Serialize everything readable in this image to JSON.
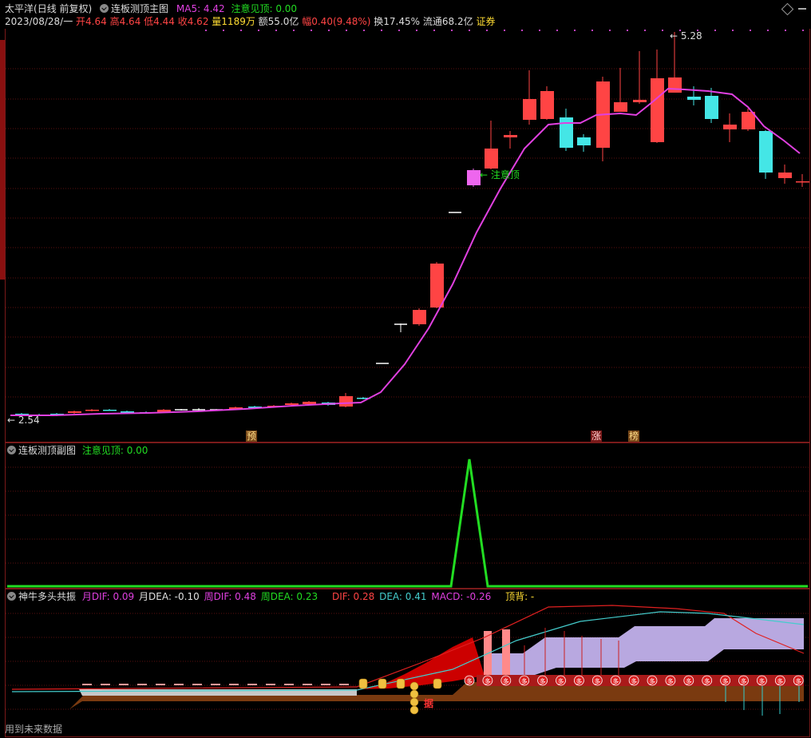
{
  "header": {
    "stock_name": "太平洋",
    "period": "(日线 前复权)",
    "main_indicator": "连板测顶主图",
    "ma5_label": "MA5: 4.42",
    "warn_label": "注意见顶: 0.00",
    "date": "2023/08/28/一",
    "open": "开4.64",
    "high": "高4.64",
    "low": "低4.44",
    "close": "收4.62",
    "volume": "量1189万",
    "amount": "额55.0亿",
    "change": "幅0.40(9.48%)",
    "turnover": "换17.45%",
    "float_cap": "流通68.2亿",
    "sector": "证券"
  },
  "main_chart": {
    "high_mark": "5.28",
    "low_mark": "2.54",
    "annotation": "注意顶",
    "tag_yu": "预",
    "tag_zhang": "涨",
    "tag_bang": "榜",
    "colors": {
      "up": "#ff4444",
      "down": "#44e6e6",
      "ma5": "#e040e0",
      "bg": "#000000"
    }
  },
  "sub_chart": {
    "title": "连板测顶副图",
    "value_label": "注意见顶: 0.00",
    "colors": {
      "line": "#22dd22"
    }
  },
  "macd_chart": {
    "title": "神牛多头共振",
    "m_dif": "月DIF: 0.09",
    "m_dea": "月DEA: -0.10",
    "w_dif": "周DIF: 0.48",
    "w_dea": "周DEA: 0.23",
    "dif": "DIF: 0.28",
    "dea": "DEA: 0.41",
    "macd": "MACD: -0.26",
    "top_div": "顶背: -",
    "duo_char": "多",
    "ju_char": "据"
  },
  "footer": {
    "note": "用到未来数据"
  }
}
